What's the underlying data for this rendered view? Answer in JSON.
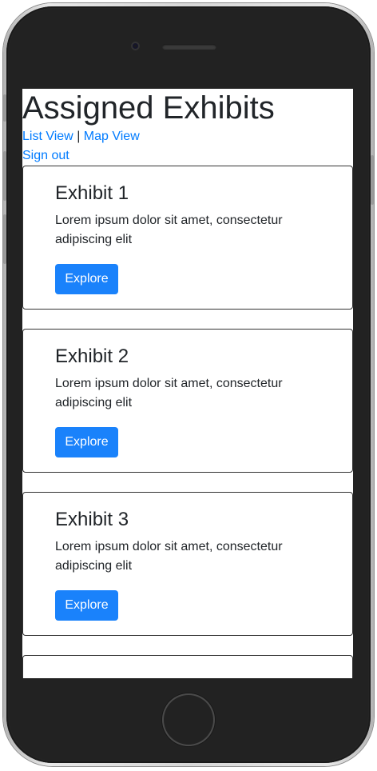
{
  "header": {
    "title": "Assigned Exhibits",
    "list_view_label": "List View",
    "separator": "|",
    "map_view_label": "Map View",
    "sign_out_label": "Sign out"
  },
  "exhibits": [
    {
      "title": "Exhibit 1",
      "description": "Lorem ipsum dolor sit amet, consectetur adipiscing elit",
      "button_label": "Explore"
    },
    {
      "title": "Exhibit 2",
      "description": "Lorem ipsum dolor sit amet, consectetur adipiscing elit",
      "button_label": "Explore"
    },
    {
      "title": "Exhibit 3",
      "description": "Lorem ipsum dolor sit amet, consectetur adipiscing elit",
      "button_label": "Explore"
    },
    {
      "title": "",
      "description": "",
      "button_label": ""
    }
  ],
  "colors": {
    "link": "#007bff",
    "button": "#1a82fb",
    "text": "#212529",
    "phone_body": "#222222"
  }
}
